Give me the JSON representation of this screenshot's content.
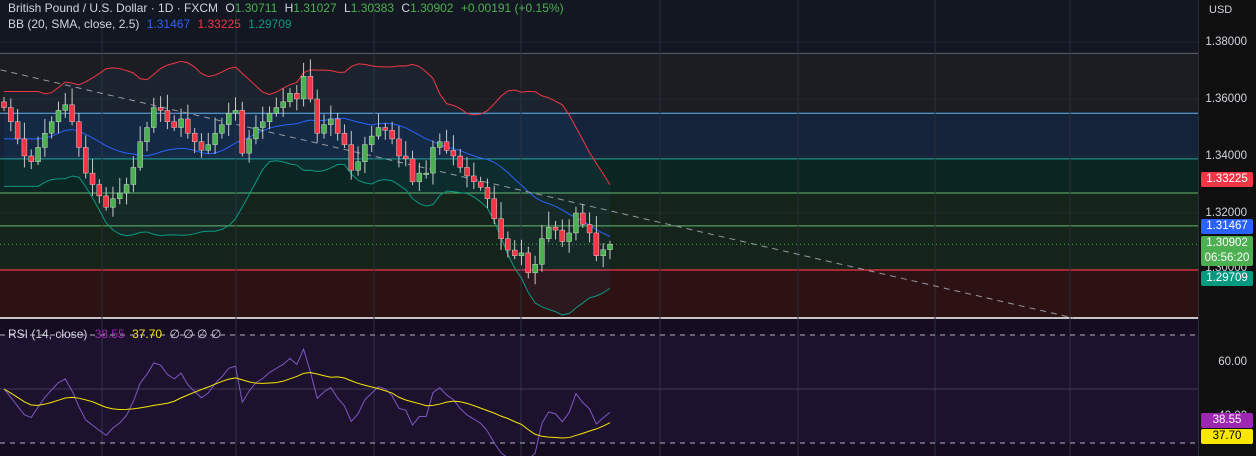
{
  "header": {
    "symbol": "British Pound / U.S. Dollar · 1D · FXCM",
    "o_label": "O",
    "o": "1.30711",
    "h_label": "H",
    "h": "1.31027",
    "l_label": "L",
    "l": "1.30383",
    "c_label": "C",
    "c": "1.30902",
    "change": "+0.00191 (+0.15%)"
  },
  "bb_legend": {
    "label": "BB (20, SMA, close, 2.5)",
    "basis": "1.31467",
    "upper": "1.33225",
    "lower": "1.29709"
  },
  "rsi_legend": {
    "label": "RSI (14, close)",
    "rsi": "38.55",
    "ma": "37.70",
    "extra": "∅ ∅ ∅ ∅"
  },
  "axis": {
    "currency": "USD",
    "price_ticks": [
      "1.38000",
      "1.36000",
      "1.34000",
      "1.32000",
      "1.30000"
    ],
    "rsi_ticks": [
      "60.00",
      "40.00"
    ],
    "badges": {
      "upper": "1.33225",
      "basis": "1.31467",
      "last": "1.30902",
      "countdown": "06:56:20",
      "lower": "1.29709",
      "rsi": "38.55",
      "rsi_ma": "37.70"
    }
  },
  "colors": {
    "up": "#4caf50",
    "down": "#f23645",
    "basis": "#2962ff",
    "upper": "#f23645",
    "lower": "#089981",
    "rsi": "#7e57c2",
    "rsi_ma": "#f7e600",
    "last": "#4caf50"
  },
  "chart_data": {
    "type": "candlestick",
    "title": "British Pound / U.S. Dollar · 1D · FXCM",
    "ylim": [
      1.28,
      1.39
    ],
    "closes": [
      1.357,
      1.352,
      1.346,
      1.34,
      1.338,
      1.343,
      1.348,
      1.352,
      1.356,
      1.358,
      1.352,
      1.343,
      1.334,
      1.33,
      1.326,
      1.322,
      1.325,
      1.327,
      1.33,
      1.336,
      1.345,
      1.35,
      1.357,
      1.356,
      1.352,
      1.35,
      1.353,
      1.348,
      1.345,
      1.342,
      1.344,
      1.348,
      1.351,
      1.355,
      1.356,
      1.341,
      1.346,
      1.35,
      1.352,
      1.355,
      1.357,
      1.359,
      1.362,
      1.36,
      1.368,
      1.36,
      1.348,
      1.351,
      1.353,
      1.348,
      1.344,
      1.335,
      1.338,
      1.344,
      1.347,
      1.35,
      1.349,
      1.346,
      1.34,
      1.339,
      1.331,
      1.334,
      1.334,
      1.343,
      1.345,
      1.342,
      1.34,
      1.336,
      1.333,
      1.331,
      1.329,
      1.325,
      1.318,
      1.311,
      1.307,
      1.305,
      1.306,
      1.299,
      1.302,
      1.311,
      1.315,
      1.314,
      1.31,
      1.313,
      1.32,
      1.316,
      1.313,
      1.305,
      1.30711,
      1.30902
    ],
    "last_ohlc": {
      "open": 1.30711,
      "high": 1.31027,
      "low": 1.30383,
      "close": 1.30902
    },
    "zones": [
      {
        "from": 1.376,
        "to": 1.355,
        "color": "#1b1d22",
        "line": "#5d606b"
      },
      {
        "from": 1.355,
        "to": 1.339,
        "color": "#14233a",
        "line": "#64b5f6"
      },
      {
        "from": 1.339,
        "to": 1.327,
        "color": "#0b2622",
        "line": "#26a69a"
      },
      {
        "from": 1.327,
        "to": 1.3,
        "color": "#15241a",
        "line": "#66bb6a"
      },
      {
        "from": 1.3,
        "to": 1.283,
        "color": "#2c1213",
        "line": "#f23645"
      }
    ],
    "extra_green_line": 1.3155,
    "trendline": {
      "from_index": -0.5,
      "from_price": 1.3702,
      "to_index": 157,
      "to_price": 1.2832
    },
    "bollinger": {
      "period": 20,
      "mult": 2.5
    },
    "rsi": {
      "period": 14,
      "ma_period": 14,
      "levels": [
        70,
        50,
        30
      ],
      "ylim": [
        25,
        75
      ]
    }
  }
}
